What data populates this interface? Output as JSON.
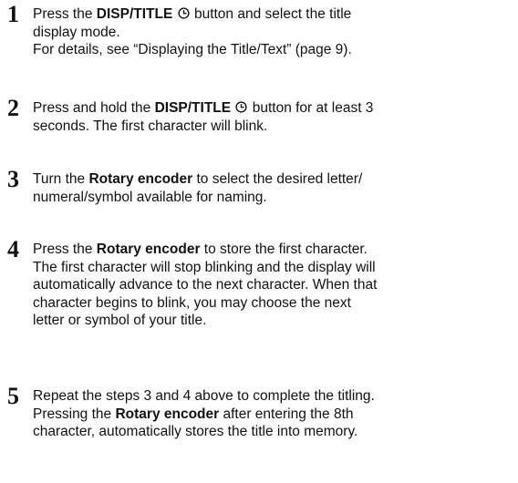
{
  "steps": [
    {
      "number": "1",
      "lines": [
        [
          {
            "t": "Press the "
          },
          {
            "t": "DISP/TITLE",
            "b": true
          },
          {
            "t": " "
          },
          {
            "icon": "clock-icon"
          },
          {
            "t": " button and select the title"
          }
        ],
        [
          {
            "t": "display mode."
          }
        ],
        [
          {
            "t": "For details, see “Displaying the Title/Text” (page 9)."
          }
        ]
      ]
    },
    {
      "number": "2",
      "lines": [
        [
          {
            "t": "Press and hold the "
          },
          {
            "t": "DISP/TITLE",
            "b": true
          },
          {
            "t": " "
          },
          {
            "icon": "clock-icon"
          },
          {
            "t": " button for at least 3"
          }
        ],
        [
          {
            "t": "seconds. The first character will blink."
          }
        ]
      ]
    },
    {
      "number": "3",
      "lines": [
        [
          {
            "t": "Turn the "
          },
          {
            "t": "Rotary encoder",
            "b": true
          },
          {
            "t": " to select the desired letter/"
          }
        ],
        [
          {
            "t": "numeral/symbol available for naming."
          }
        ]
      ]
    },
    {
      "number": "4",
      "lines": [
        [
          {
            "t": "Press the "
          },
          {
            "t": "Rotary encoder",
            "b": true
          },
          {
            "t": " to store the first character."
          }
        ],
        [
          {
            "t": "The first character will stop blinking and the display will"
          }
        ],
        [
          {
            "t": "automatically advance to the next character. When that"
          }
        ],
        [
          {
            "t": "character begins to blink, you may choose the next"
          }
        ],
        [
          {
            "t": "letter or symbol of your title."
          }
        ]
      ]
    },
    {
      "number": "5",
      "lines": [
        [
          {
            "t": "Repeat the steps 3 and 4 above to complete the titling."
          }
        ],
        [
          {
            "t": "Pressing the "
          },
          {
            "t": "Rotary encoder",
            "b": true
          },
          {
            "t": " after entering the 8th"
          }
        ],
        [
          {
            "t": "character, automatically stores the title into memory."
          }
        ]
      ]
    }
  ]
}
